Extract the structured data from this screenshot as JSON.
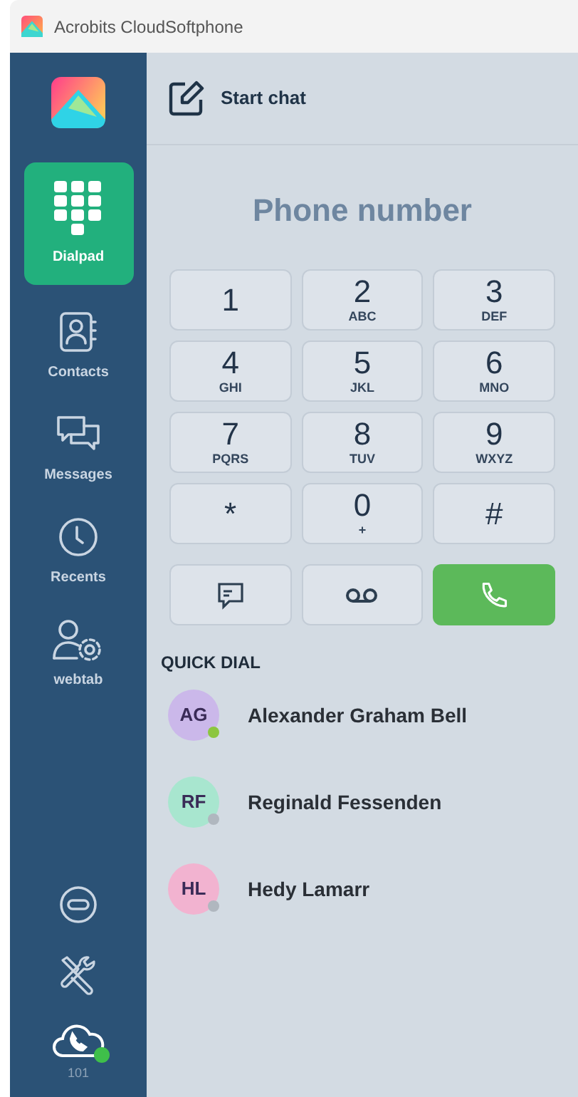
{
  "window": {
    "title": "Acrobits CloudSoftphone"
  },
  "sidebar": {
    "items": [
      {
        "kind": "dialpad",
        "label": "Dialpad",
        "selected": true
      },
      {
        "kind": "contacts",
        "label": "Contacts",
        "selected": false
      },
      {
        "kind": "messages",
        "label": "Messages",
        "selected": false
      },
      {
        "kind": "recents",
        "label": "Recents",
        "selected": false
      },
      {
        "kind": "webtab",
        "label": "webtab",
        "selected": false
      }
    ],
    "account": {
      "label": "101",
      "online": true
    }
  },
  "header": {
    "label": "Start chat"
  },
  "dialpad": {
    "placeholder": "Phone number",
    "keys": [
      {
        "digit": "1"
      },
      {
        "digit": "2",
        "letters": "ABC"
      },
      {
        "digit": "3",
        "letters": "DEF"
      },
      {
        "digit": "4",
        "letters": "GHI"
      },
      {
        "digit": "5",
        "letters": "JKL"
      },
      {
        "digit": "6",
        "letters": "MNO"
      },
      {
        "digit": "7",
        "letters": "PQRS"
      },
      {
        "digit": "8",
        "letters": "TUV"
      },
      {
        "digit": "9",
        "letters": "WXYZ"
      },
      {
        "digit": "*"
      },
      {
        "digit": "0",
        "letters": "+"
      },
      {
        "digit": "#"
      }
    ]
  },
  "quick_dial": {
    "title": "QUICK DIAL",
    "contacts": [
      {
        "initials": "AG",
        "name": "Alexander Graham Bell",
        "color": "#cbb8ea",
        "online": true
      },
      {
        "initials": "RF",
        "name": "Reginald Fessenden",
        "color": "#a8e6cf",
        "online": false
      },
      {
        "initials": "HL",
        "name": "Hedy Lamarr",
        "color": "#f2b3d0",
        "online": false
      }
    ]
  }
}
